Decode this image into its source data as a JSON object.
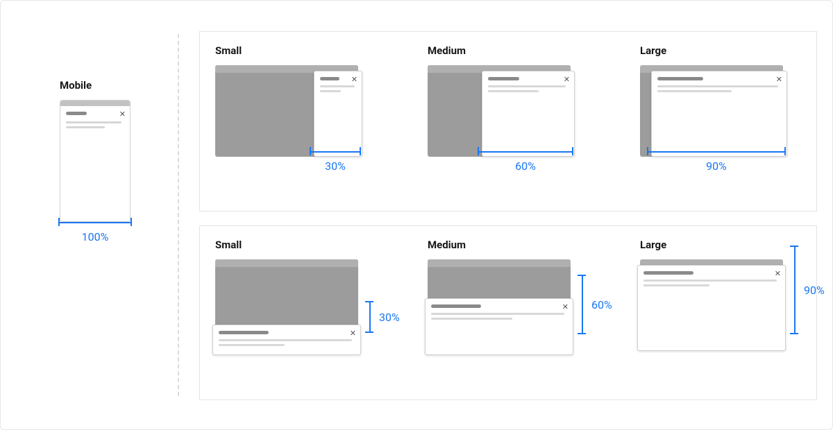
{
  "mobile": {
    "label": "Mobile",
    "dimension": "100%"
  },
  "width_row": {
    "sizes": [
      {
        "label": "Small",
        "dimension": "30%"
      },
      {
        "label": "Medium",
        "dimension": "60%"
      },
      {
        "label": "Large",
        "dimension": "90%"
      }
    ]
  },
  "height_row": {
    "sizes": [
      {
        "label": "Small",
        "dimension": "30%"
      },
      {
        "label": "Medium",
        "dimension": "60%"
      },
      {
        "label": "Large",
        "dimension": "90%"
      }
    ]
  },
  "diagram": {
    "description": "Responsive panel sizing across breakpoints",
    "width_varies_axis": "horizontal",
    "height_varies_axis": "vertical",
    "dimension_color": "#1976f2"
  }
}
